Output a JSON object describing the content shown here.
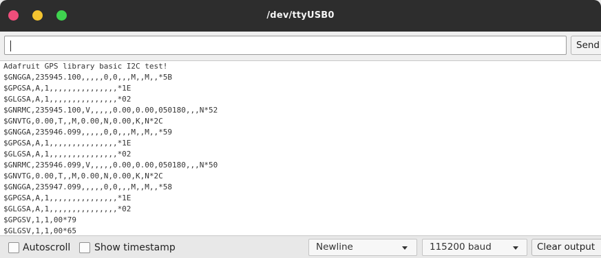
{
  "window": {
    "title": "/dev/ttyUSB0",
    "colors": {
      "close": "#ef4e7b",
      "minimize": "#f4c430",
      "maximize": "#3fd34f",
      "titlebar": "#2d2d2d"
    }
  },
  "input": {
    "value": "",
    "send_label": "Send"
  },
  "output": {
    "lines": [
      "Adafruit GPS library basic I2C test!",
      "$GNGGA,235945.100,,,,,0,0,,,M,,M,,*5B",
      "$GPGSA,A,1,,,,,,,,,,,,,,,*1E",
      "$GLGSA,A,1,,,,,,,,,,,,,,,*02",
      "$GNRMC,235945.100,V,,,,,0.00,0.00,050180,,,N*52",
      "$GNVTG,0.00,T,,M,0.00,N,0.00,K,N*2C",
      "$GNGGA,235946.099,,,,,0,0,,,M,,M,,*59",
      "$GPGSA,A,1,,,,,,,,,,,,,,,*1E",
      "$GLGSA,A,1,,,,,,,,,,,,,,,*02",
      "$GNRMC,235946.099,V,,,,,0.00,0.00,050180,,,N*50",
      "$GNVTG,0.00,T,,M,0.00,N,0.00,K,N*2C",
      "$GNGGA,235947.099,,,,,0,0,,,M,,M,,*58",
      "$GPGSA,A,1,,,,,,,,,,,,,,,*1E",
      "$GLGSA,A,1,,,,,,,,,,,,,,,*02",
      "$GPGSV,1,1,00*79",
      "$GLGSV,1,1,00*65"
    ]
  },
  "footer": {
    "autoscroll_label": "Autoscroll",
    "timestamp_label": "Show timestamp",
    "line_ending": "Newline",
    "baud_rate": "115200 baud",
    "clear_label": "Clear output"
  }
}
